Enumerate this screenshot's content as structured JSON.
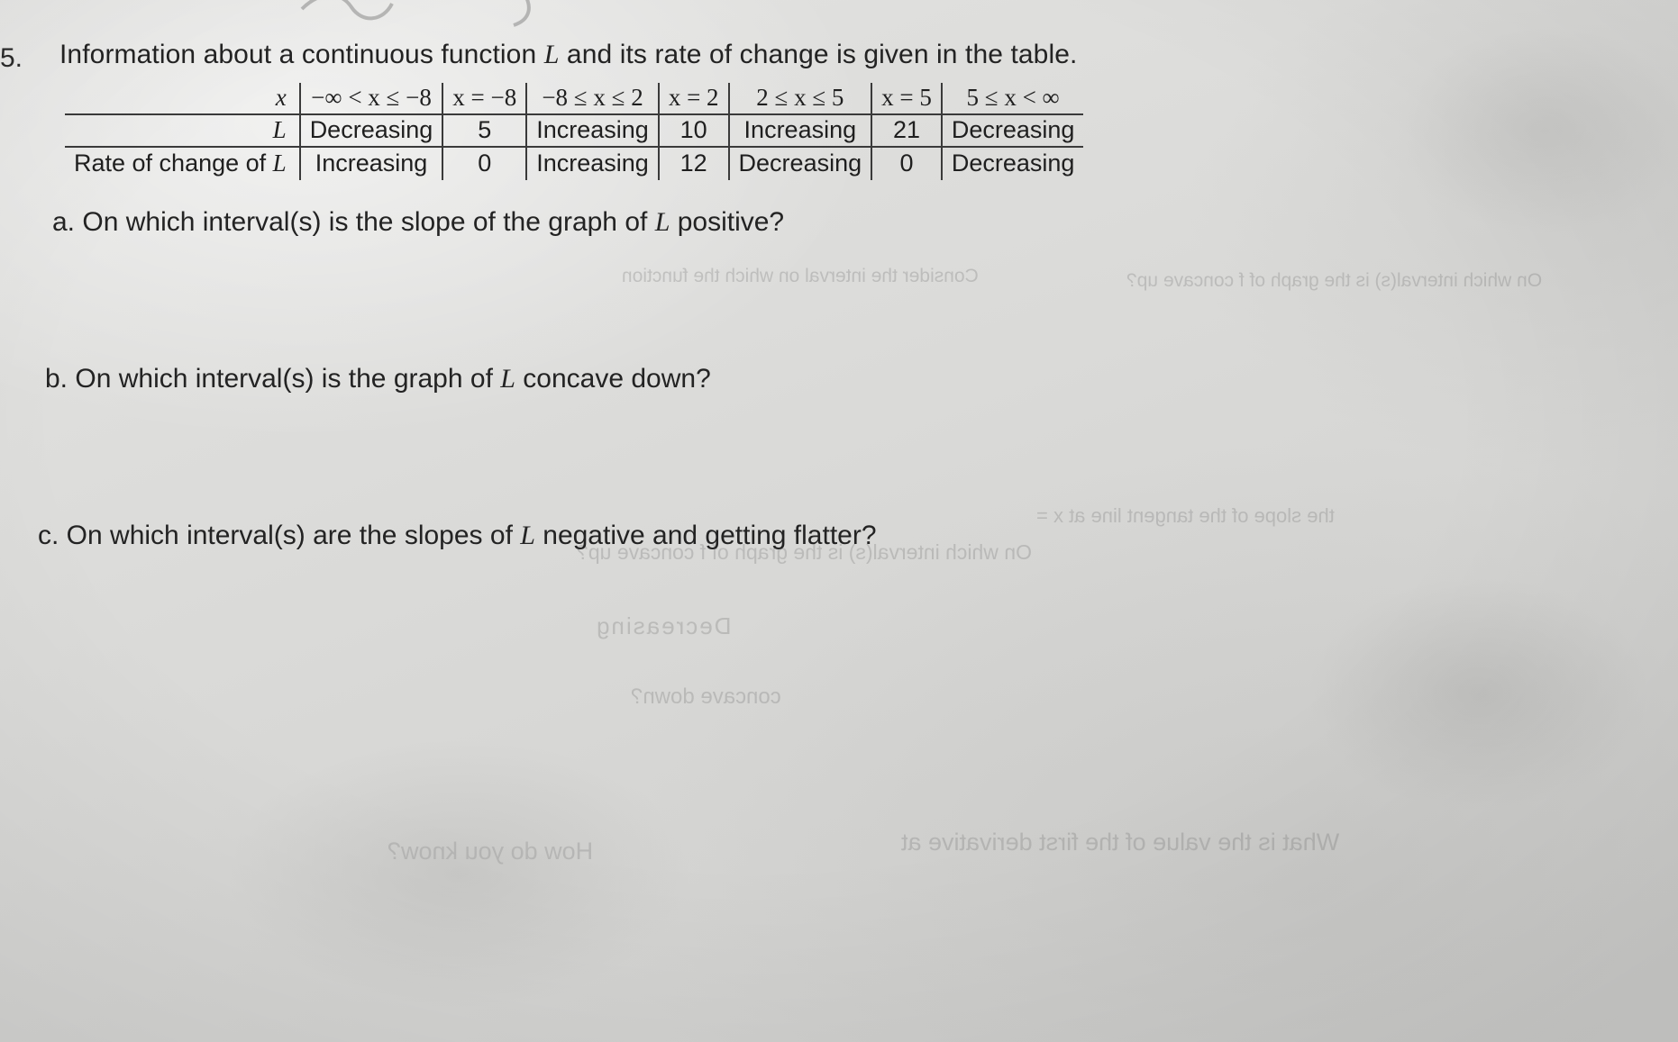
{
  "document": {
    "question_number": "5.",
    "stem_prefix": "Information about a continuous function ",
    "stem_var": "L",
    "stem_suffix": " and its rate of change is given in the table.",
    "table": {
      "row_labels": [
        "x",
        "L",
        "Rate of change of L"
      ],
      "row_label_plain": [
        "x",
        "L",
        "Rate of change of "
      ],
      "row_label_var": "L",
      "columns": [
        "−∞ < x ≤ −8",
        "x = −8",
        "−8 ≤ x ≤ 2",
        "x = 2",
        "2 ≤ x ≤ 5",
        "x = 5",
        "5 ≤ x < ∞"
      ],
      "row_L": [
        "Decreasing",
        "5",
        "Increasing",
        "10",
        "Increasing",
        "21",
        "Decreasing"
      ],
      "row_rate": [
        "Increasing",
        "0",
        "Increasing",
        "12",
        "Decreasing",
        "0",
        "Decreasing"
      ]
    },
    "parts": [
      {
        "label": "a.",
        "prefix": " On which interval(s) is the slope of the graph of ",
        "var": "L",
        "suffix": " positive?"
      },
      {
        "label": "b.",
        "prefix": " On which interval(s) is the graph of ",
        "var": "L",
        "suffix": " concave down?"
      },
      {
        "label": "c.",
        "prefix": " On which interval(s) are the slopes of ",
        "var": "L",
        "suffix": " negative and getting flatter?"
      }
    ],
    "bleed_through": [
      "Consider the interval on which the function",
      "On which interval(s) is the graph of f concave up?",
      "the slope of the tangent line at x =",
      "Decreasing",
      "What is the value of the first derivative at",
      "How do you know?",
      "concave down?"
    ],
    "colors": {
      "paper": "#d9d9d7",
      "ink": "#232323",
      "rule": "#3a3a3a"
    }
  }
}
